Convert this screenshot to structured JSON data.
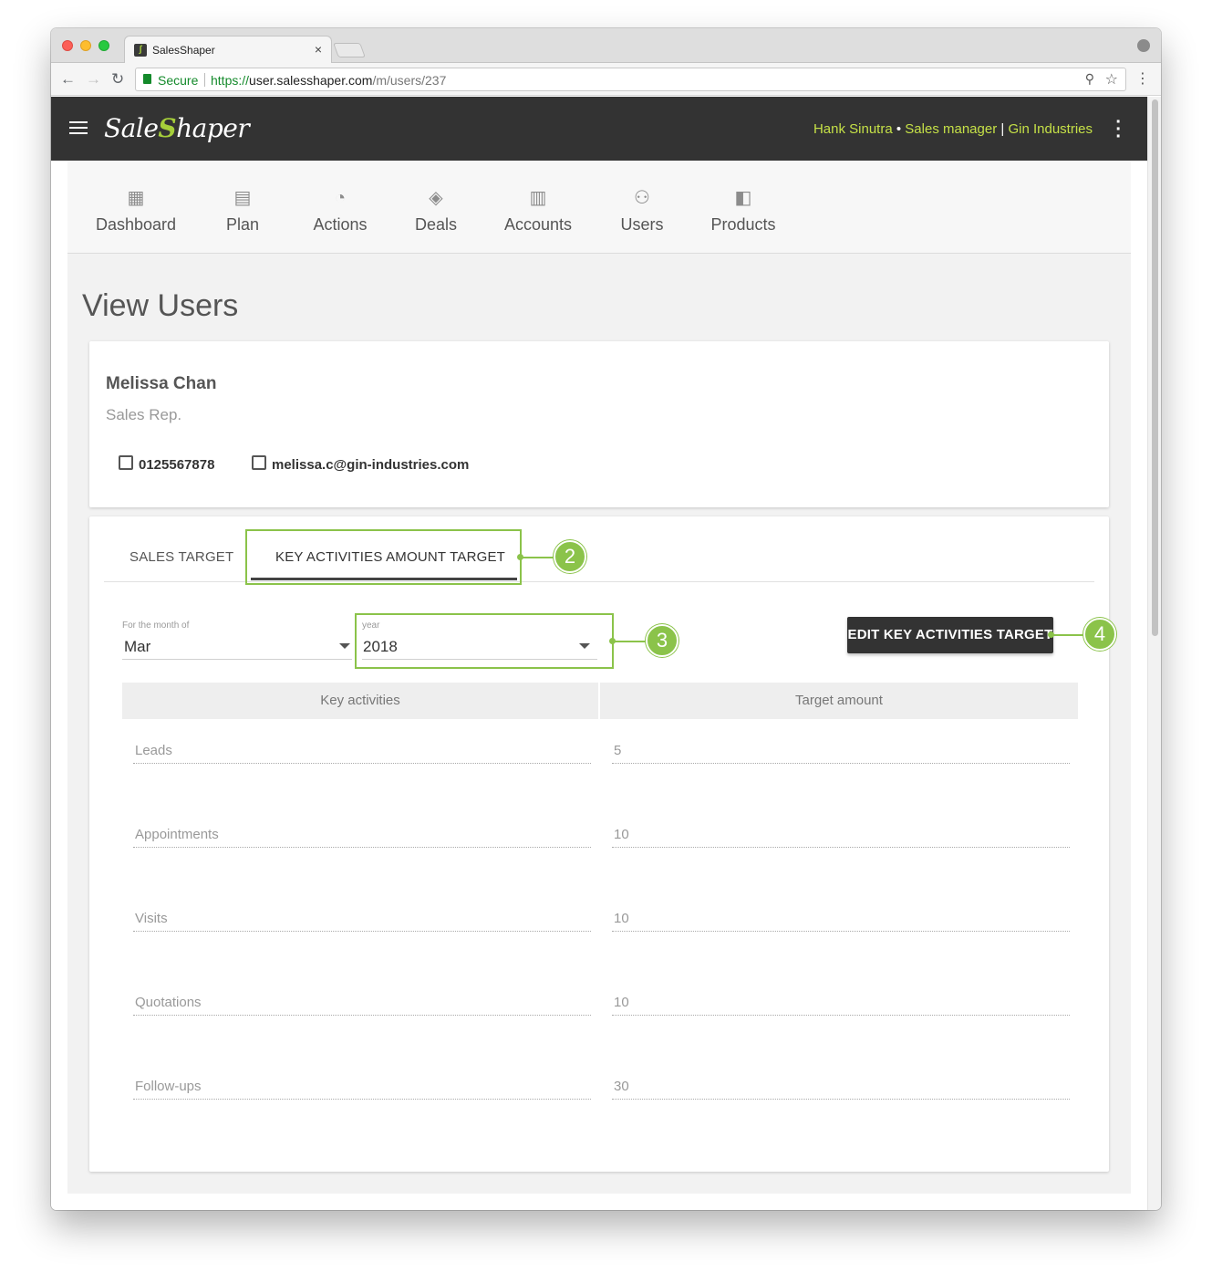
{
  "browser": {
    "tab_title": "SalesShaper",
    "tab_close": "×",
    "secure_label": "Secure",
    "url_scheme": "https://",
    "url_host": "user.salesshaper.com",
    "url_path": "/m/users/237"
  },
  "header": {
    "logo_part1": "Sale",
    "logo_accent": "S",
    "logo_part2": "haper",
    "user_name": "Hank Sinutra",
    "user_role": "Sales manager",
    "company": "Gin Industries",
    "dot": "•",
    "pipe": "|"
  },
  "nav": {
    "items": [
      {
        "label": "Dashboard",
        "icon": "dashboard-icon"
      },
      {
        "label": "Plan",
        "icon": "plan-icon"
      },
      {
        "label": "Actions",
        "icon": "actions-icon"
      },
      {
        "label": "Deals",
        "icon": "deals-icon"
      },
      {
        "label": "Accounts",
        "icon": "accounts-icon"
      },
      {
        "label": "Users",
        "icon": "users-icon"
      },
      {
        "label": "Products",
        "icon": "products-icon"
      }
    ]
  },
  "page": {
    "title": "View Users"
  },
  "user": {
    "name": "Melissa Chan",
    "role": "Sales Rep.",
    "phone": "0125567878",
    "email": "melissa.c@gin-industries.com"
  },
  "targets": {
    "tabs": [
      {
        "label": "SALES TARGET",
        "active": false
      },
      {
        "label": "KEY ACTIVITIES AMOUNT TARGET",
        "active": true
      }
    ],
    "month_label": "For the month of",
    "month_value": "Mar",
    "year_label": "year",
    "year_value": "2018",
    "edit_button": "EDIT KEY ACTIVITIES TARGET",
    "columns": [
      "Key activities",
      "Target amount"
    ],
    "rows": [
      {
        "activity": "Leads",
        "amount": "5"
      },
      {
        "activity": "Appointments",
        "amount": "10"
      },
      {
        "activity": "Visits",
        "amount": "10"
      },
      {
        "activity": "Quotations",
        "amount": "10"
      },
      {
        "activity": "Follow-ups",
        "amount": "30"
      }
    ]
  },
  "callouts": [
    "2",
    "3",
    "4"
  ],
  "colors": {
    "header_bg": "#333333",
    "accent_green": "#a6cf3a",
    "user_info": "#c5e047",
    "callout": "#8bc34a"
  }
}
